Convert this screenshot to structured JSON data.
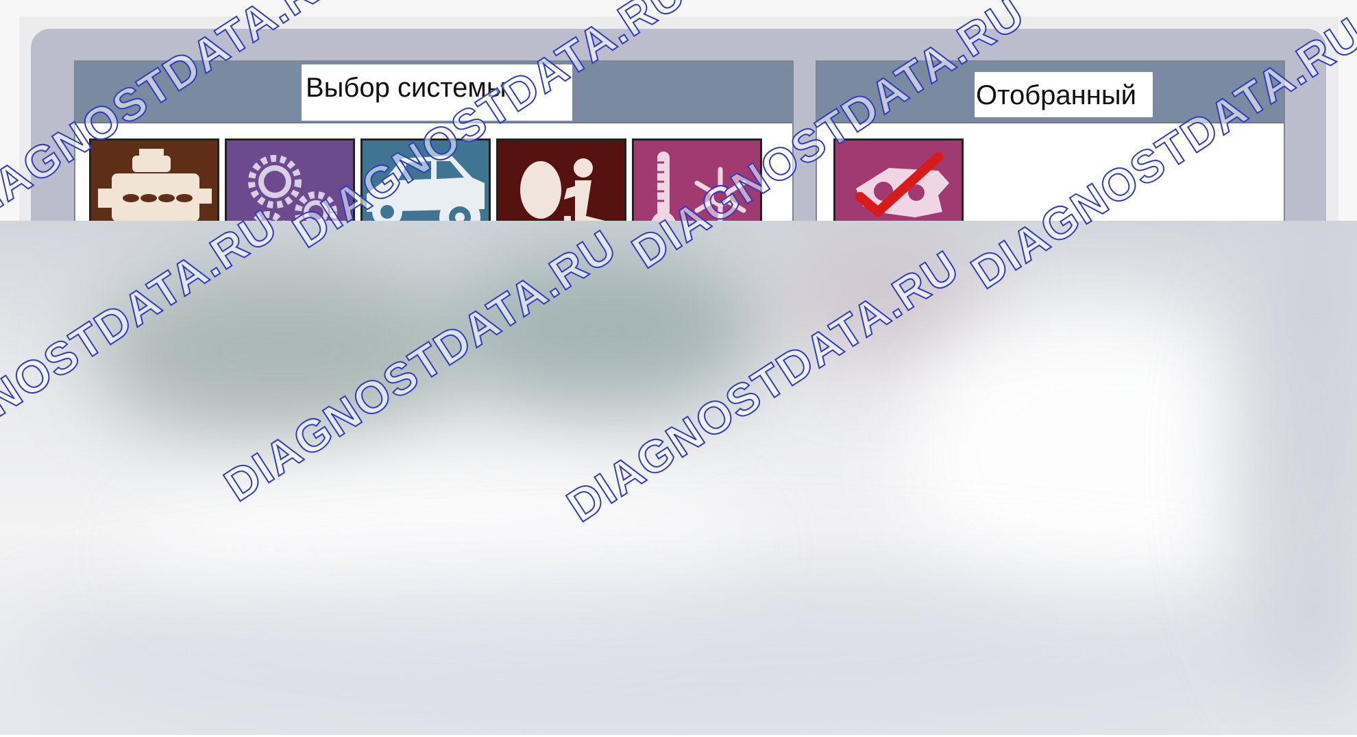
{
  "left_panel": {
    "title": "Выбор системы",
    "tiles": [
      {
        "icon": "engine-icon",
        "background": "#5e2e17"
      },
      {
        "icon": "gears-icon",
        "background": "#6d4a8d"
      },
      {
        "icon": "car-chassis-icon",
        "background": "#3f7592"
      },
      {
        "icon": "airbag-icon",
        "background": "#55120e"
      },
      {
        "icon": "climate-control-icon",
        "background": "#a03a70"
      }
    ]
  },
  "right_panel": {
    "title": "Отобранный",
    "tiles": [
      {
        "icon": "selected-system-check-icon",
        "background": "#a03a70",
        "checkmark_color": "#d91a1a"
      }
    ]
  },
  "watermark": {
    "text": "DIAGNOSTDATA.RU",
    "stroke_color": "#2f3cc2"
  }
}
